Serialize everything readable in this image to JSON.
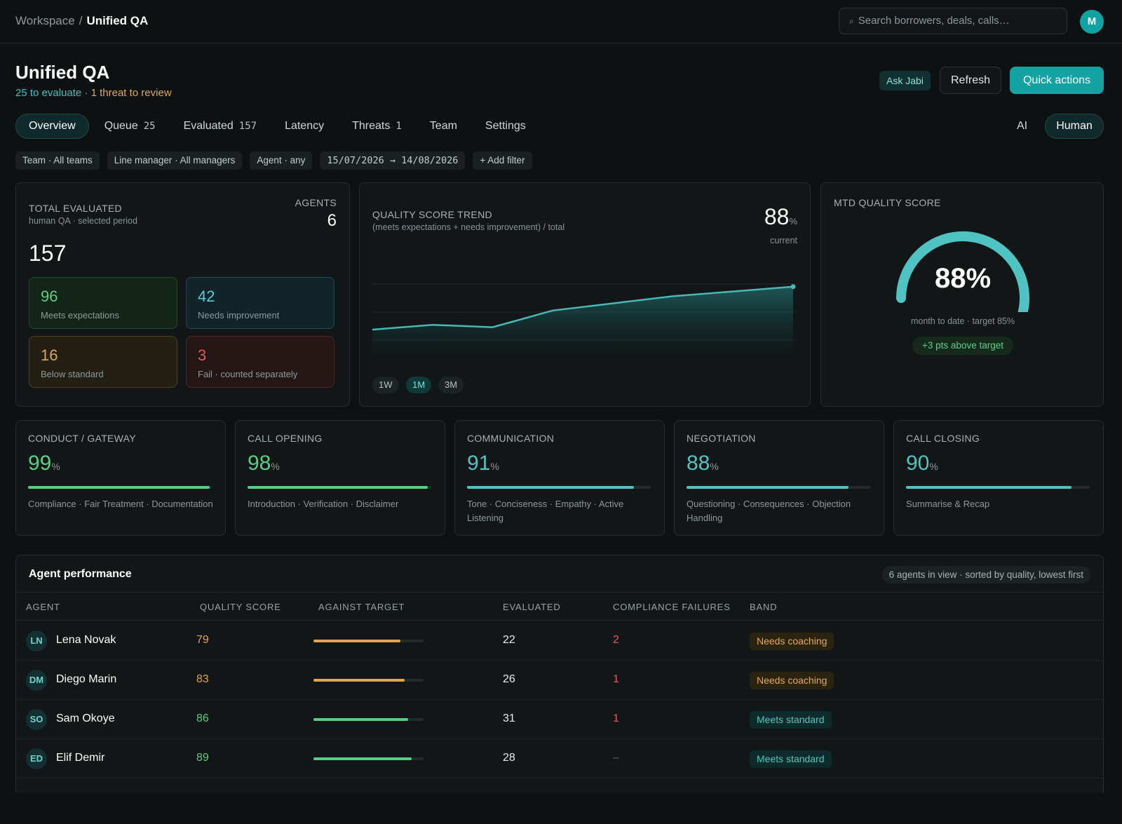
{
  "breadcrumb": {
    "root": "Workspace",
    "separator": "/",
    "current": "Unified QA"
  },
  "search": {
    "placeholder": "Search borrowers, deals, calls…"
  },
  "user": {
    "initial": "M"
  },
  "header": {
    "title": "Unified QA",
    "subtitle_eval": "25 to evaluate",
    "subtitle_sep": "·",
    "subtitle_threat": "1 threat to review",
    "ask_label": "Ask Jabi",
    "refresh_label": "Refresh",
    "quick_label": "Quick actions"
  },
  "tabs": [
    {
      "label": "Overview",
      "count": ""
    },
    {
      "label": "Queue",
      "count": "25"
    },
    {
      "label": "Evaluated",
      "count": "157"
    },
    {
      "label": "Latency",
      "count": ""
    },
    {
      "label": "Threats",
      "count": "1"
    },
    {
      "label": "Team",
      "count": ""
    },
    {
      "label": "Settings",
      "count": ""
    }
  ],
  "mode": {
    "ai": "AI",
    "human": "Human"
  },
  "filters": [
    "Team · All teams",
    "Line manager · All managers",
    "Agent · any",
    "15/07/2026 → 14/08/2026",
    "+ Add filter"
  ],
  "total": {
    "label": "TOTAL EVALUATED",
    "sublabel": "human QA · selected period",
    "value": "157",
    "agents_label": "AGENTS",
    "agents_value": "6",
    "stats": [
      {
        "value": "96",
        "label": "Meets expectations"
      },
      {
        "value": "42",
        "label": "Needs improvement"
      },
      {
        "value": "16",
        "label": "Below standard"
      },
      {
        "value": "3",
        "label": "Fail · counted separately"
      }
    ]
  },
  "trend": {
    "label": "QUALITY SCORE TREND",
    "sublabel": "(meets expectations + needs improvement) / total",
    "current_value": "88",
    "unit": "%",
    "current_label": "current",
    "ranges": [
      "1W",
      "1M",
      "3M"
    ],
    "active_range": "1M"
  },
  "chart_data": {
    "type": "area",
    "title": "QUALITY SCORE TREND",
    "x": [
      0,
      1,
      2,
      3,
      4,
      5,
      6,
      7
    ],
    "values": [
      79.5,
      80.5,
      80,
      83.5,
      85,
      86.5,
      87.5,
      88.5
    ],
    "ylim": [
      72,
      92
    ],
    "grid": true,
    "color": "#47b8b6"
  },
  "mtd": {
    "label": "MTD QUALITY SCORE",
    "value_text": "88%",
    "value": 88,
    "target_text": "month to date · target 85%",
    "delta_text": "+3 pts above target",
    "gauge_color": "#4fc3c1"
  },
  "categories": [
    {
      "label": "CONDUCT / GATEWAY",
      "value": "99",
      "fill": 99,
      "color": "#56cf84",
      "desc": "Compliance · Fair Treatment · Documentation"
    },
    {
      "label": "CALL OPENING",
      "value": "98",
      "fill": 98,
      "color": "#56cf84",
      "desc": "Introduction · Verification · Disclaimer"
    },
    {
      "label": "COMMUNICATION",
      "value": "91",
      "fill": 91,
      "color": "#4fc3c1",
      "desc": "Tone · Conciseness · Empathy · Active Listening"
    },
    {
      "label": "NEGOTIATION",
      "value": "88",
      "fill": 88,
      "color": "#4fc3c1",
      "desc": "Questioning · Consequences · Objection Handling"
    },
    {
      "label": "CALL CLOSING",
      "value": "90",
      "fill": 90,
      "color": "#4fc3c1",
      "desc": "Summarise & Recap"
    }
  ],
  "agents_table": {
    "title": "Agent performance",
    "meta": "6 agents in view · sorted by quality, lowest first",
    "columns": [
      "AGENT",
      "QUALITY SCORE",
      "AGAINST TARGET",
      "EVALUATED",
      "COMPLIANCE FAILURES",
      "BAND"
    ],
    "rows": [
      {
        "initials": "LN",
        "name": "Lena Novak",
        "score": "79",
        "fill": 79,
        "evaluated": "22",
        "failures": "2",
        "band": "Needs coaching"
      },
      {
        "initials": "DM",
        "name": "Diego Marin",
        "score": "83",
        "fill": 83,
        "evaluated": "26",
        "failures": "1",
        "band": "Needs coaching"
      },
      {
        "initials": "SO",
        "name": "Sam Okoye",
        "score": "86",
        "fill": 86,
        "evaluated": "31",
        "failures": "1",
        "band": "Meets standard"
      },
      {
        "initials": "ED",
        "name": "Elif Demir",
        "score": "89",
        "fill": 89,
        "evaluated": "28",
        "failures": "–",
        "band": "Meets standard"
      }
    ]
  },
  "colors": {
    "accent": "#12a3a2",
    "good": "#56cf84",
    "warn": "#e0a44c",
    "bad": "#e35a5a"
  }
}
